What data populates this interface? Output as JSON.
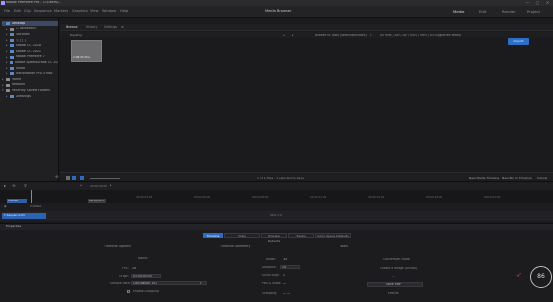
{
  "window": {
    "title": "Adobe Premiere Pro - C:\\Users\\...",
    "controls": [
      "—",
      "▢",
      "✕"
    ]
  },
  "menubar": {
    "items": [
      "File",
      "Edit",
      "Clip",
      "Sequence",
      "Markers",
      "Graphics",
      "View",
      "Window",
      "Help"
    ],
    "center_label": "Media Browser",
    "workspaces": [
      {
        "label": "Media",
        "active": true
      },
      {
        "label": "Edit",
        "active": false
      },
      {
        "label": "Render",
        "active": false
      },
      {
        "label": "Project",
        "active": false
      }
    ]
  },
  "sidebar": {
    "items": [
      {
        "label": "Desktop",
        "selected": true,
        "depth": 0,
        "twisty": "▾",
        "folder": "blue"
      },
      {
        "label": "C: Windows7",
        "selected": false,
        "depth": 1,
        "twisty": "▸",
        "folder": "grey"
      },
      {
        "label": "Libraries",
        "selected": false,
        "depth": 1,
        "twisty": "▸",
        "folder": "blue"
      },
      {
        "label": "I [ ] [ ]",
        "selected": false,
        "depth": 1,
        "twisty": "▸",
        "folder": "blue"
      },
      {
        "label": "Adobe CC 2018",
        "selected": false,
        "depth": 1,
        "twisty": "▸",
        "folder": "blue"
      },
      {
        "label": "Adobe CC 2021",
        "selected": false,
        "depth": 1,
        "twisty": "▸",
        "folder": "blue"
      },
      {
        "label": "Adobe Premiere 7",
        "selected": false,
        "depth": 1,
        "twisty": "▸",
        "folder": "blue"
      },
      {
        "label": "Adobe SpeedGrade CC 2014",
        "selected": false,
        "depth": 1,
        "twisty": "▸",
        "folder": "blue"
      },
      {
        "label": "photo",
        "selected": false,
        "depth": 1,
        "twisty": "▸",
        "folder": "blue"
      },
      {
        "label": "TransMotion Pro 4 Mac",
        "selected": false,
        "depth": 1,
        "twisty": "▸",
        "folder": "blue"
      },
      {
        "label": "Home",
        "selected": false,
        "depth": 0,
        "twisty": "▸",
        "folder": "grey"
      },
      {
        "label": "Network",
        "selected": false,
        "depth": 0,
        "twisty": "▸",
        "folder": "grey"
      },
      {
        "label": "Recently Saved Folders",
        "selected": false,
        "depth": 0,
        "twisty": "▾",
        "folder": "grey"
      },
      {
        "label": "Drawings",
        "selected": false,
        "depth": 1,
        "twisty": "▸",
        "folder": "blue"
      }
    ]
  },
  "media_panel": {
    "tabs": [
      {
        "label": "Browse",
        "active": true
      },
      {
        "label": "History",
        "active": false
      },
      {
        "label": "Settings",
        "active": false
      }
    ],
    "location": "Desktop",
    "path_label": "Browse to Tools (selectWithState)",
    "filter_label": "All Files / AVI / DV / MOV / MP4 / All Supported Media",
    "thumbnail_label": "2:08:05.Mov",
    "import_button": "Import",
    "status_center": "1 of 1 Files - 1 selected to Save",
    "footer_buttons": [
      "New Media Timeline",
      "New Bin in Timeline",
      "Cancel"
    ]
  },
  "timeline": {
    "timecode": "00:00:00:00",
    "toolbar_items": [
      "⟲",
      "⚲",
      "◂",
      "▸"
    ],
    "ruler_ticks": [
      "00:00:03:00",
      "00:00:06:00",
      "00:00:09:00",
      "00:00:12:00",
      "00:00:15:00",
      "00:00:18:00",
      "00:00:21:00"
    ],
    "track_v1_label": "Untitled",
    "clip_label": "Background",
    "selected_track_label": "1 Sequence 01",
    "center_indicator": "00:0 1:0"
  },
  "properties": {
    "tab_label": "Properties",
    "segments": [
      {
        "label": "Timeline",
        "active": true
      },
      {
        "label": "Video",
        "active": false
      },
      {
        "label": "Preview Defaults",
        "active": false
      },
      {
        "label": "Tracks",
        "active": false
      },
      {
        "label": "Color Space Defaults",
        "active": false
      }
    ],
    "sections": {
      "left": "Timeline Options",
      "center": "Timeline Geometry",
      "right": "Tools"
    },
    "left_fields": {
      "header": "Name:",
      "fps_label": "FPS:",
      "fps_value": "24",
      "origin_label": "Origin:",
      "origin_value": "01:00:00:00",
      "sample_label": "Sample Rate:",
      "sample_value": "Calculation 1x1",
      "drop_frame_label": "Enable Dropping"
    },
    "center_fields": {
      "width_label": "Width:",
      "width_value": "33",
      "distance_label": "Distance:",
      "distance_value": "24",
      "scroll_label": "Scroll Step:",
      "scroll_value": "1",
      "pan_label": "Pan & Scale:",
      "pan_value": "—",
      "grouping_label": "Grouping:",
      "grouping_value": "— —"
    },
    "right_fields": {
      "header": "Conversion Mode",
      "line1": "Create a Image (Artists)",
      "line2": "—",
      "button": "Save XMP",
      "line3": "Effects"
    },
    "badge": "86",
    "colors": {
      "accent": "#2e6ac2",
      "folder": "#5d89c4",
      "alert": "#c53a3a"
    }
  }
}
